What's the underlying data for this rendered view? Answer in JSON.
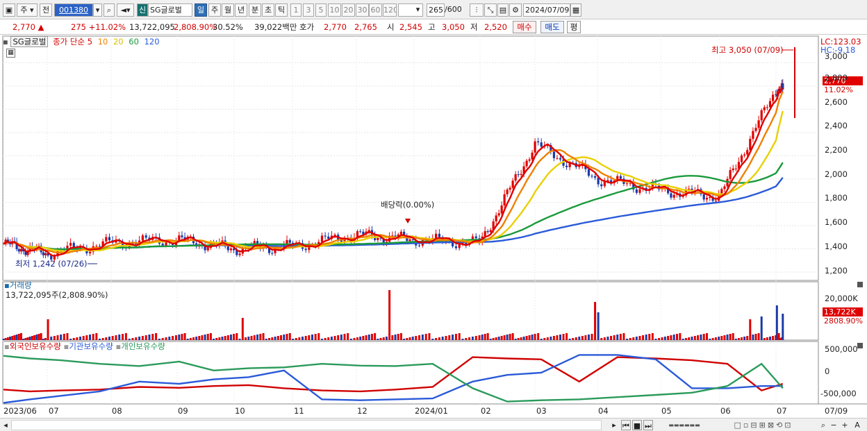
{
  "toolbar": {
    "market_label": "주",
    "prev_label": "전",
    "code": "001380",
    "new_label": "신",
    "stock_name": "SG글로벌",
    "periods": [
      "일",
      "주",
      "월",
      "년",
      "분",
      "초",
      "틱"
    ],
    "intervals": [
      "1",
      "3",
      "5",
      "10",
      "20",
      "30",
      "60",
      "120"
    ],
    "count": "265",
    "count_max": "/600",
    "date": "2024/07/09"
  },
  "info": {
    "price": "2,770",
    "change": "275 +11.02%",
    "volume": "13,722,095",
    "volume_ratio": "2,808.90%",
    "turnover": "30.52%",
    "amount": "39,022백만",
    "quote_label": "호가",
    "ask": "2,770",
    "bid": "2,765",
    "open_label": "시",
    "open": "2,545",
    "high_label": "고",
    "high": "3,050",
    "low_label": "저",
    "low": "2,520",
    "buy_label": "매수",
    "sell_label": "매도",
    "eval_label": "평"
  },
  "price_panel": {
    "stock_tag": "SG글로벌",
    "ma_label": "종가 단순",
    "ma": [
      {
        "period": "5",
        "color": "#e00000"
      },
      {
        "period": "10",
        "color": "#f08000"
      },
      {
        "period": "20",
        "color": "#e8d000"
      },
      {
        "period": "60",
        "color": "#1a9a3a"
      },
      {
        "period": "120",
        "color": "#2a5ad8"
      }
    ],
    "lc_label": "LC:123.03",
    "hc_label": "HC:-9.18",
    "max_annotation": "최고 3,050 (07/09)",
    "min_annotation": "최저 1,242 (07/26)",
    "dividend_annotation": "배당락(0.00%)",
    "current_price_tag": "2,770",
    "current_change_tag": "11.02%",
    "y_ticks": [
      "3,000",
      "2,800",
      "2,600",
      "2,400",
      "2,200",
      "2,000",
      "1,800",
      "1,600",
      "1,400",
      "1,200"
    ]
  },
  "volume_panel": {
    "title": "거래량",
    "value": "13,722,095주(2,808.90%)",
    "y_tick": "20,000K",
    "tag_value": "13,722K",
    "tag_ratio": "2808.90%"
  },
  "holdings_panel": {
    "legend": [
      {
        "label": "외국인보유수량",
        "color": "#d00000"
      },
      {
        "label": "기관보유수량",
        "color": "#2a5ad8"
      },
      {
        "label": "개인보유수량",
        "color": "#2a9a5a"
      }
    ],
    "y_ticks": [
      "500,000",
      "0",
      "-500,000"
    ]
  },
  "x_axis": {
    "labels": [
      "2023/06",
      "07",
      "08",
      "09",
      "10",
      "11",
      "12",
      "2024/01",
      "02",
      "03",
      "04",
      "05",
      "06",
      "07"
    ],
    "right_label": "07/09"
  },
  "chart_data": {
    "type": "candlestick",
    "title": "SG글로벌",
    "price_ylim": [
      1200,
      3050
    ],
    "price_series": {
      "x": [
        "2023/06",
        "07",
        "08",
        "09",
        "10",
        "11",
        "12",
        "2024/01",
        "02",
        "03",
        "04",
        "05",
        "06",
        "07"
      ],
      "close_approx": [
        1440,
        1360,
        1450,
        1480,
        1400,
        1420,
        1520,
        1480,
        1450,
        2300,
        2000,
        1900,
        1850,
        2770
      ]
    },
    "ma_series": [
      {
        "name": "120",
        "values": [
          1430,
          1360,
          1350,
          1370,
          1380,
          1400,
          1420,
          1440,
          1460,
          1490,
          1600,
          1700,
          1780,
          1920
        ]
      },
      {
        "name": "60",
        "values": [
          1380,
          1380,
          1410,
          1440,
          1440,
          1440,
          1450,
          1460,
          1480,
          1600,
          1850,
          2000,
          2050,
          2080
        ]
      }
    ],
    "max": {
      "value": 3050,
      "date": "07/09"
    },
    "min": {
      "value": 1242,
      "date": "07/26"
    },
    "volume_tag": "13,722K",
    "holdings_ylim": [
      -500000,
      500000
    ]
  }
}
